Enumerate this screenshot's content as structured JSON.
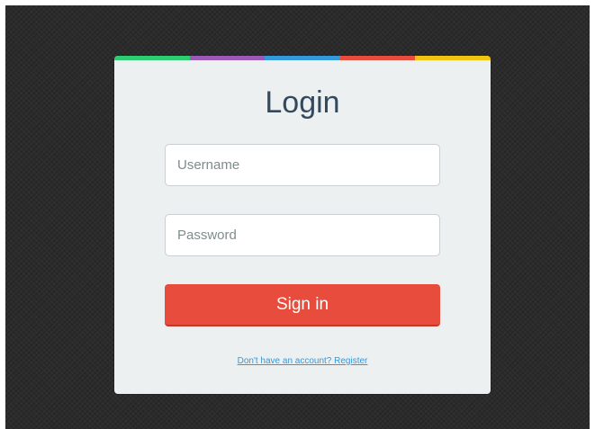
{
  "colors": {
    "backdrop": "#2b2b2b",
    "card": "#ecf0f1",
    "title": "#34495e",
    "signin_button": "#e74c3c",
    "link": "#3498db",
    "accent_bar": [
      "#2ecc71",
      "#9b59b6",
      "#3498db",
      "#e74c3c",
      "#f1c40f"
    ]
  },
  "login": {
    "title": "Login",
    "username": {
      "value": "",
      "placeholder": "Username"
    },
    "password": {
      "value": "",
      "placeholder": "Password"
    },
    "signin_label": "Sign in",
    "register_link": "Don't have an account? Register"
  }
}
